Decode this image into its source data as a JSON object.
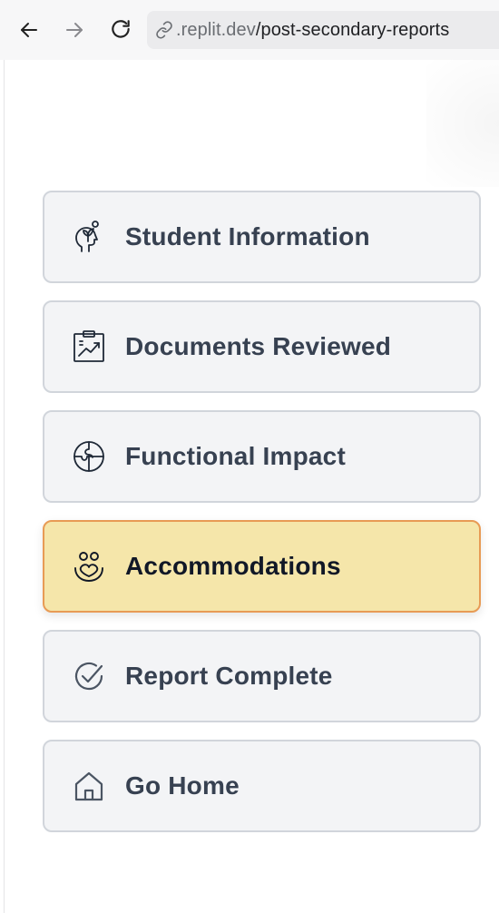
{
  "browser": {
    "url_prefix": ".replit.dev",
    "url_path": "/post-secondary-reports"
  },
  "menu": {
    "items": [
      {
        "label": "Student Information",
        "icon": "head-sprout-icon",
        "active": false
      },
      {
        "label": "Documents Reviewed",
        "icon": "clipboard-chart-icon",
        "active": false
      },
      {
        "label": "Functional Impact",
        "icon": "puzzle-globe-icon",
        "active": false
      },
      {
        "label": "Accommodations",
        "icon": "hands-heart-icon",
        "active": true
      },
      {
        "label": "Report Complete",
        "icon": "check-circle-icon",
        "active": false
      },
      {
        "label": "Go Home",
        "icon": "home-icon",
        "active": false
      }
    ]
  },
  "colors": {
    "item_bg": "#f3f4f6",
    "item_border": "#d1d5db",
    "active_bg": "#f5e6aa",
    "active_border": "#e89b55",
    "label": "#374151"
  }
}
